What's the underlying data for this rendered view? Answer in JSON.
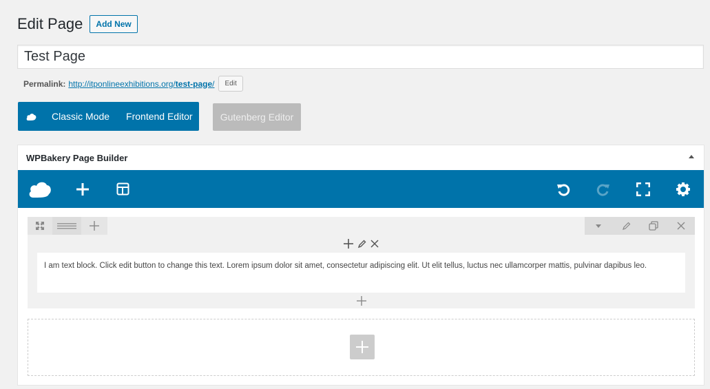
{
  "header": {
    "title": "Edit Page",
    "add_new_label": "Add New"
  },
  "title_field": {
    "value": "Test Page"
  },
  "permalink": {
    "label": "Permalink:",
    "url_base": "http://itponlineexhibitions.org/",
    "url_slug": "test-page",
    "url_trailing": "/",
    "edit_label": "Edit"
  },
  "editor_modes": {
    "classic_label": "Classic Mode",
    "frontend_label": "Frontend Editor",
    "gutenberg_label": "Gutenberg Editor"
  },
  "panel": {
    "title": "WPBakery Page Builder"
  },
  "toolbar": {
    "icons": [
      "wpbakery-logo-icon",
      "add-element-icon",
      "templates-icon",
      "undo-icon",
      "redo-icon",
      "fullscreen-icon",
      "settings-icon"
    ]
  },
  "content": {
    "text_block": "I am text block. Click edit button to change this text. Lorem ipsum dolor sit amet, consectetur adipiscing elit. Ut elit tellus, luctus nec ullamcorper mattis, pulvinar dapibus leo."
  },
  "colors": {
    "accent": "#0073aa",
    "disabled_button": "#bbbbbb",
    "row_bg": "#f1f1f1"
  }
}
